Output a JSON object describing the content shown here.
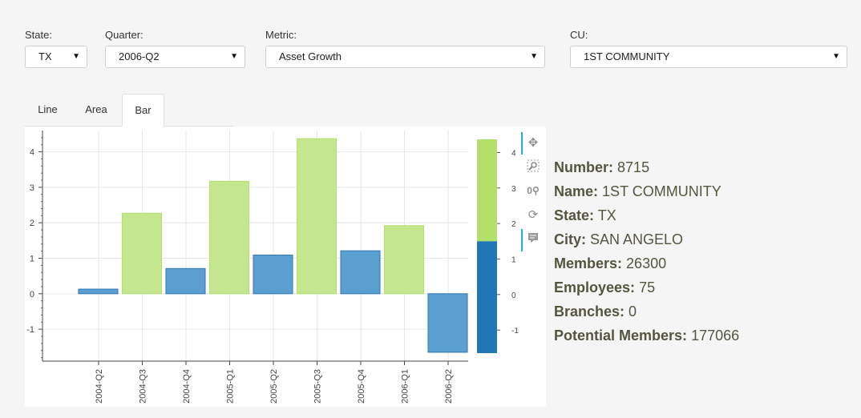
{
  "filters": {
    "state": {
      "label": "State:",
      "value": "TX"
    },
    "quarter": {
      "label": "Quarter:",
      "value": "2006-Q2"
    },
    "metric": {
      "label": "Metric:",
      "value": "Asset Growth"
    },
    "cu": {
      "label": "CU:",
      "value": "1ST COMMUNITY"
    }
  },
  "tabs": [
    {
      "label": "Line",
      "active": false
    },
    {
      "label": "Area",
      "active": false
    },
    {
      "label": "Bar",
      "active": true
    }
  ],
  "toolbar": {
    "tools": [
      "pan-icon",
      "box-zoom-icon",
      "wheel-zoom-icon",
      "reset-icon",
      "hover-icon"
    ]
  },
  "chart_data": {
    "type": "bar",
    "categories": [
      "2004-Q2",
      "2004-Q3",
      "2004-Q4",
      "2005-Q1",
      "2005-Q2",
      "2005-Q3",
      "2005-Q4",
      "2006-Q1",
      "2006-Q2"
    ],
    "values": [
      0.13,
      2.27,
      0.71,
      3.17,
      1.09,
      4.37,
      1.21,
      1.92,
      -1.65
    ],
    "ylim": [
      -1.9,
      4.6
    ],
    "yticks": [
      -1,
      0,
      1,
      2,
      3,
      4
    ],
    "grid": true,
    "colors": {
      "positive_high": "#b2e06b",
      "positive_low": "#1f77b4",
      "negative": "#1f77b4"
    },
    "color_threshold": 1.5,
    "colorbar": {
      "ticks": [
        -1,
        0,
        1,
        2,
        3,
        4
      ],
      "range": [
        -1.65,
        4.37
      ],
      "colors": [
        "#1f77b4",
        "#b2e06b"
      ]
    }
  },
  "info": [
    {
      "key": "Number:",
      "value": "8715"
    },
    {
      "key": "Name:",
      "value": "1ST COMMUNITY"
    },
    {
      "key": "State:",
      "value": "TX"
    },
    {
      "key": "City:",
      "value": "SAN ANGELO"
    },
    {
      "key": "Members:",
      "value": "26300"
    },
    {
      "key": "Employees:",
      "value": "75"
    },
    {
      "key": "Branches:",
      "value": "0"
    },
    {
      "key": "Potential Members:",
      "value": "177066"
    }
  ]
}
